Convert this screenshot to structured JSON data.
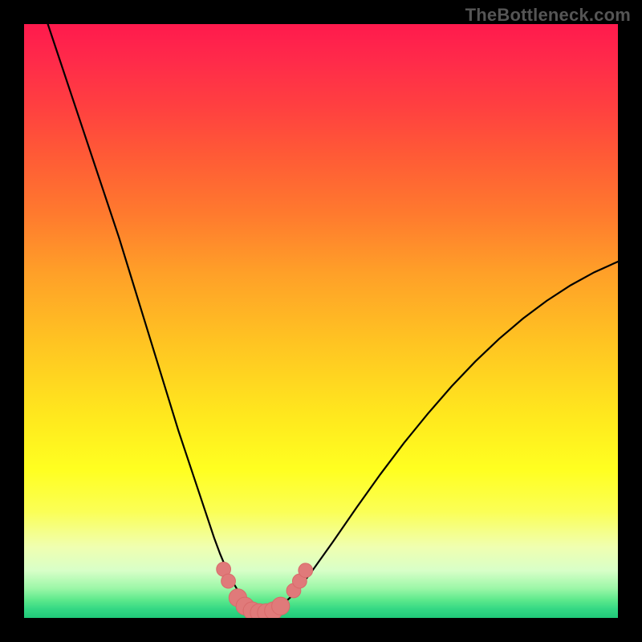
{
  "watermark": "TheBottleneck.com",
  "colors": {
    "background": "#000000",
    "curve_stroke": "#000000",
    "marker_fill": "#e07a7a",
    "marker_stroke": "#d86a6a"
  },
  "chart_data": {
    "type": "line",
    "title": "",
    "xlabel": "",
    "ylabel": "",
    "xlim": [
      0,
      100
    ],
    "ylim": [
      0,
      100
    ],
    "grid": false,
    "legend": false,
    "series": [
      {
        "name": "bottleneck-curve",
        "x": [
          4,
          6,
          8,
          10,
          12,
          14,
          16,
          18,
          20,
          22,
          24,
          26,
          28,
          30,
          32,
          33,
          34,
          35,
          36,
          37,
          38,
          39,
          40,
          41,
          42,
          43,
          45,
          48,
          52,
          56,
          60,
          64,
          68,
          72,
          76,
          80,
          84,
          88,
          92,
          96,
          100
        ],
        "values": [
          100,
          94,
          88,
          82,
          76,
          70,
          64,
          57.5,
          51,
          44.5,
          38,
          31.5,
          25.5,
          19.5,
          13.5,
          10.8,
          8.4,
          6.3,
          4.6,
          3.2,
          2.2,
          1.5,
          1.1,
          1.0,
          1.2,
          1.8,
          3.6,
          7.2,
          12.8,
          18.6,
          24.2,
          29.5,
          34.4,
          39.0,
          43.2,
          47.0,
          50.4,
          53.4,
          56.0,
          58.2,
          60.0
        ]
      }
    ],
    "markers": [
      {
        "x": 33.6,
        "y": 8.2,
        "r": 1.2
      },
      {
        "x": 34.4,
        "y": 6.2,
        "r": 1.2
      },
      {
        "x": 36.0,
        "y": 3.4,
        "r": 1.5
      },
      {
        "x": 37.2,
        "y": 2.0,
        "r": 1.5
      },
      {
        "x": 38.4,
        "y": 1.2,
        "r": 1.5
      },
      {
        "x": 39.6,
        "y": 0.9,
        "r": 1.5
      },
      {
        "x": 40.8,
        "y": 0.9,
        "r": 1.5
      },
      {
        "x": 42.0,
        "y": 1.2,
        "r": 1.5
      },
      {
        "x": 43.2,
        "y": 2.0,
        "r": 1.5
      },
      {
        "x": 45.4,
        "y": 4.6,
        "r": 1.2
      },
      {
        "x": 46.4,
        "y": 6.2,
        "r": 1.2
      },
      {
        "x": 47.4,
        "y": 8.0,
        "r": 1.2
      }
    ]
  }
}
